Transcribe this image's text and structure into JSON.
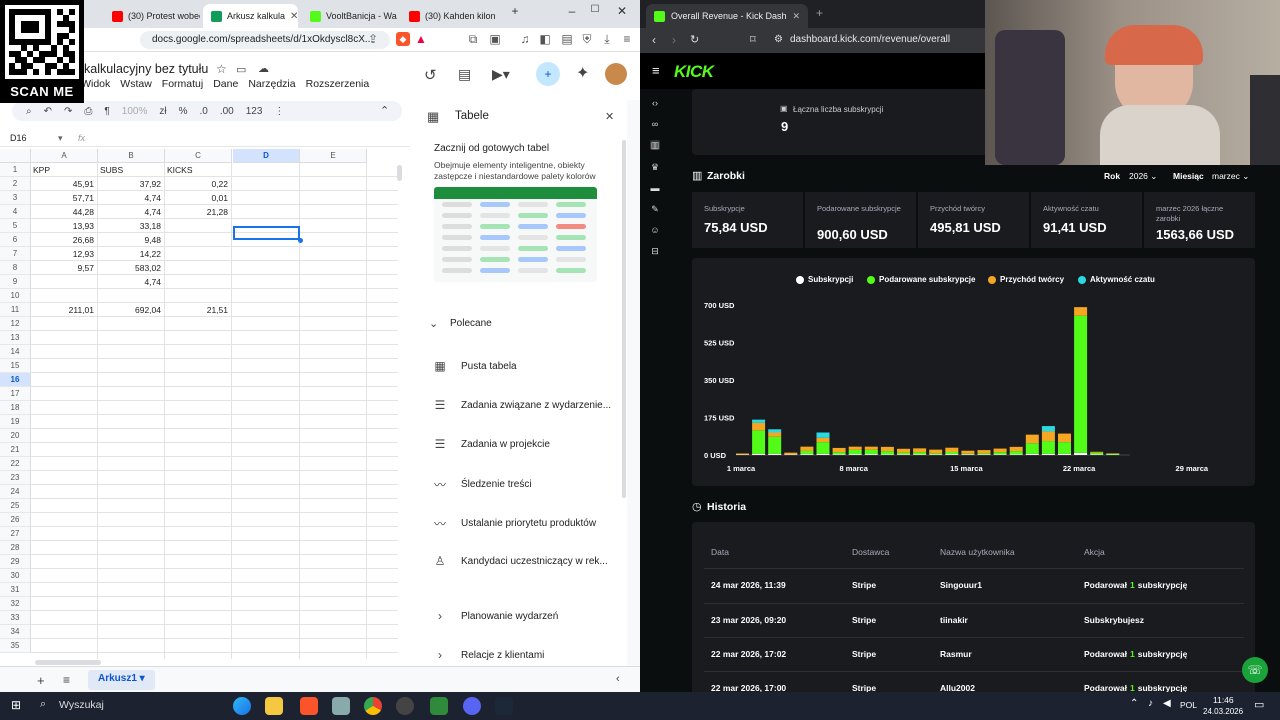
{
  "left_browser": {
    "tabs": [
      {
        "label": "la",
        "color": "#ea4335"
      },
      {
        "label": "(30) Protest wobec",
        "color": "#ff0000"
      },
      {
        "label": "Arkusz kalkula",
        "color": "#0f9d58",
        "active": true
      },
      {
        "label": "VooltBanicja - Wa",
        "color": "#53fc18"
      },
      {
        "label": "(30) Kahden kilon",
        "color": "#ff0000"
      }
    ],
    "new_tab": "+",
    "win_min": "–",
    "win_max": "☐",
    "win_close": "✕",
    "url": "docs.google.com/spreadsheets/d/1xOkdyscl8cX..."
  },
  "qr": {
    "label": "SCAN ME"
  },
  "sheets": {
    "title": "kalkulacyjny bez tytułu",
    "menu": [
      "tuj",
      "Widok",
      "Wstaw",
      "Formatuj",
      "Dane",
      "Narzędzia",
      "Rozszerzenia"
    ],
    "toolbar": {
      "zoom": "100%",
      "currency": "zł",
      "percent": "%",
      "dec_less": ".0",
      "dec_more": ".00",
      "num_format": "123",
      "more": "⋮"
    },
    "name_box": "D16",
    "fx": "fx",
    "columns": [
      "A",
      "B",
      "C",
      "D",
      "E"
    ],
    "active_column": "D",
    "active_row": 16,
    "row_count": 35,
    "cells": [
      {
        "r": 1,
        "c": "A",
        "v": "KPP",
        "num": false
      },
      {
        "r": 1,
        "c": "B",
        "v": "SUBS",
        "num": false
      },
      {
        "r": 1,
        "c": "C",
        "v": "KICKS",
        "num": false
      },
      {
        "r": 2,
        "c": "A",
        "v": "45,91",
        "num": true
      },
      {
        "r": 2,
        "c": "B",
        "v": "37,92",
        "num": true
      },
      {
        "r": 2,
        "c": "C",
        "v": "0,22",
        "num": true
      },
      {
        "r": 3,
        "c": "A",
        "v": "57,71",
        "num": true
      },
      {
        "r": 3,
        "c": "B",
        "v": "4,74",
        "num": true
      },
      {
        "r": 3,
        "c": "C",
        "v": "0,01",
        "num": true
      },
      {
        "r": 4,
        "c": "A",
        "v": "44,28",
        "num": true
      },
      {
        "r": 4,
        "c": "B",
        "v": "4,74",
        "num": true
      },
      {
        "r": 4,
        "c": "C",
        "v": "21,28",
        "num": true
      },
      {
        "r": 5,
        "c": "A",
        "v": "13,93",
        "num": true
      },
      {
        "r": 5,
        "c": "B",
        "v": "33,18",
        "num": true
      },
      {
        "r": 6,
        "c": "A",
        "v": "26,68",
        "num": true
      },
      {
        "r": 6,
        "c": "B",
        "v": "9,48",
        "num": true
      },
      {
        "r": 7,
        "c": "A",
        "v": "12,93",
        "num": true
      },
      {
        "r": 7,
        "c": "B",
        "v": "14,22",
        "num": true
      },
      {
        "r": 8,
        "c": "A",
        "v": "9,57",
        "num": true
      },
      {
        "r": 8,
        "c": "B",
        "v": "583,02",
        "num": true
      },
      {
        "r": 9,
        "c": "B",
        "v": "4,74",
        "num": true
      },
      {
        "r": 11,
        "c": "A",
        "v": "211,01",
        "num": true
      },
      {
        "r": 11,
        "c": "B",
        "v": "692,04",
        "num": true
      },
      {
        "r": 11,
        "c": "C",
        "v": "21,51",
        "num": true
      }
    ],
    "sheet_tab": "Arkusz1",
    "add_sheet": "+",
    "sheet_list": "≡"
  },
  "tables_panel": {
    "title": "Tabele",
    "close": "✕",
    "ready_title": "Zacznij od gotowych tabel",
    "ready_desc": "Obejmuje elementy inteligentne, obiekty zastępcze i niestandardowe palety kolorów",
    "recommended": "Polecane",
    "items": [
      {
        "label": "Pusta tabela",
        "icon": "table-icon"
      },
      {
        "label": "Zadania związane z wydarzenie...",
        "icon": "checklist-icon"
      },
      {
        "label": "Zadania w projekcie",
        "icon": "checklist-icon"
      },
      {
        "label": "Śledzenie treści",
        "icon": "trend-icon"
      },
      {
        "label": "Ustalanie priorytetu produktów",
        "icon": "trend-icon"
      },
      {
        "label": "Kandydaci uczestniczący w rek...",
        "icon": "person-icon"
      }
    ],
    "sections": [
      "Planowanie wydarzeń",
      "Relacje z klientami"
    ]
  },
  "right_browser": {
    "tab_title": "Overall Revenue - Kick Dashboa",
    "url": "dashboard.kick.com/revenue/overall"
  },
  "kick": {
    "logo": "KICK",
    "subs_total_label": "Łączna liczba subskrypcji",
    "subs_total_value": "9",
    "earnings_title": "Zarobki",
    "year_label": "Rok",
    "year_value": "2026",
    "month_label": "Miesiąc",
    "month_value": "marzec",
    "stats": [
      {
        "label": "Subskrypcje",
        "value": "75,84 USD"
      },
      {
        "label": "Podarowane subskrypcje",
        "value": "900,60 USD"
      },
      {
        "label": "Przychód twórcy",
        "value": "495,81 USD"
      },
      {
        "label": "Aktywność czatu",
        "value": "91,41 USD"
      },
      {
        "label": "marzec 2026 łączne zarobki",
        "value": "1563,66 USD"
      }
    ],
    "colors": {
      "subs": "#ffffff",
      "gifted": "#53fc18",
      "creator": "#f5a623",
      "chat": "#2bd9e0"
    },
    "history_title": "Historia",
    "history_headers": [
      "Data",
      "Dostawca",
      "Nazwa użytkownika",
      "Akcja"
    ],
    "history_rows": [
      {
        "date": "24 mar 2026, 11:39",
        "provider": "Stripe",
        "user": "Singouur1",
        "action_pre": "Podarował",
        "action_num": "1",
        "action_post": "subskrypcję"
      },
      {
        "date": "23 mar 2026, 09:20",
        "provider": "Stripe",
        "user": "tiinakir",
        "action_pre": "Subskrybujesz",
        "action_num": "",
        "action_post": ""
      },
      {
        "date": "22 mar 2026, 17:02",
        "provider": "Stripe",
        "user": "Rasmur",
        "action_pre": "Podarował",
        "action_num": "1",
        "action_post": "subskrypcję"
      },
      {
        "date": "22 mar 2026, 17:00",
        "provider": "Stripe",
        "user": "Allu2002",
        "action_pre": "Podarował",
        "action_num": "1",
        "action_post": "subskrypcję"
      }
    ]
  },
  "chart_data": {
    "type": "bar",
    "stacked": true,
    "series": [
      {
        "name": "Subskrypcji"
      },
      {
        "name": "Podarowane subskrypcje"
      },
      {
        "name": "Przychód twórcy"
      },
      {
        "name": "Aktywność czatu"
      }
    ],
    "yticks": [
      "0 USD",
      "175 USD",
      "350 USD",
      "525 USD",
      "700 USD"
    ],
    "ylim": [
      0,
      700
    ],
    "xticks": [
      "1 marca",
      "8 marca",
      "15 marca",
      "22 marca",
      "29 marca"
    ],
    "days": [
      {
        "day": 1,
        "values": [
          2,
          0,
          5,
          0
        ]
      },
      {
        "day": 2,
        "values": [
          5,
          110,
          35,
          15
        ]
      },
      {
        "day": 3,
        "values": [
          5,
          80,
          20,
          15
        ]
      },
      {
        "day": 4,
        "values": [
          3,
          0,
          8,
          0
        ]
      },
      {
        "day": 5,
        "values": [
          4,
          15,
          20,
          0
        ]
      },
      {
        "day": 6,
        "values": [
          5,
          55,
          20,
          25
        ]
      },
      {
        "day": 7,
        "values": [
          3,
          10,
          20,
          0
        ]
      },
      {
        "day": 8,
        "values": [
          4,
          20,
          15,
          0
        ]
      },
      {
        "day": 9,
        "values": [
          4,
          20,
          15,
          0
        ]
      },
      {
        "day": 10,
        "values": [
          3,
          15,
          20,
          0
        ]
      },
      {
        "day": 11,
        "values": [
          3,
          8,
          18,
          0
        ]
      },
      {
        "day": 12,
        "values": [
          3,
          10,
          18,
          0
        ]
      },
      {
        "day": 13,
        "values": [
          3,
          5,
          17,
          0
        ]
      },
      {
        "day": 14,
        "values": [
          4,
          10,
          20,
          0
        ]
      },
      {
        "day": 15,
        "values": [
          3,
          3,
          14,
          0
        ]
      },
      {
        "day": 16,
        "values": [
          3,
          5,
          15,
          0
        ]
      },
      {
        "day": 17,
        "values": [
          3,
          10,
          17,
          0
        ]
      },
      {
        "day": 18,
        "values": [
          3,
          15,
          20,
          0
        ]
      },
      {
        "day": 19,
        "values": [
          5,
          50,
          40,
          0
        ]
      },
      {
        "day": 20,
        "values": [
          5,
          60,
          45,
          25
        ]
      },
      {
        "day": 21,
        "values": [
          5,
          55,
          40,
          0
        ]
      },
      {
        "day": 22,
        "values": [
          10,
          640,
          40,
          0
        ]
      },
      {
        "day": 23,
        "values": [
          3,
          8,
          4,
          0
        ]
      },
      {
        "day": 24,
        "values": [
          2,
          4,
          2,
          0
        ]
      }
    ]
  },
  "taskbar": {
    "search": "Wyszukaj",
    "lang": "POL",
    "time": "11:46",
    "date": "24.03.2026"
  }
}
